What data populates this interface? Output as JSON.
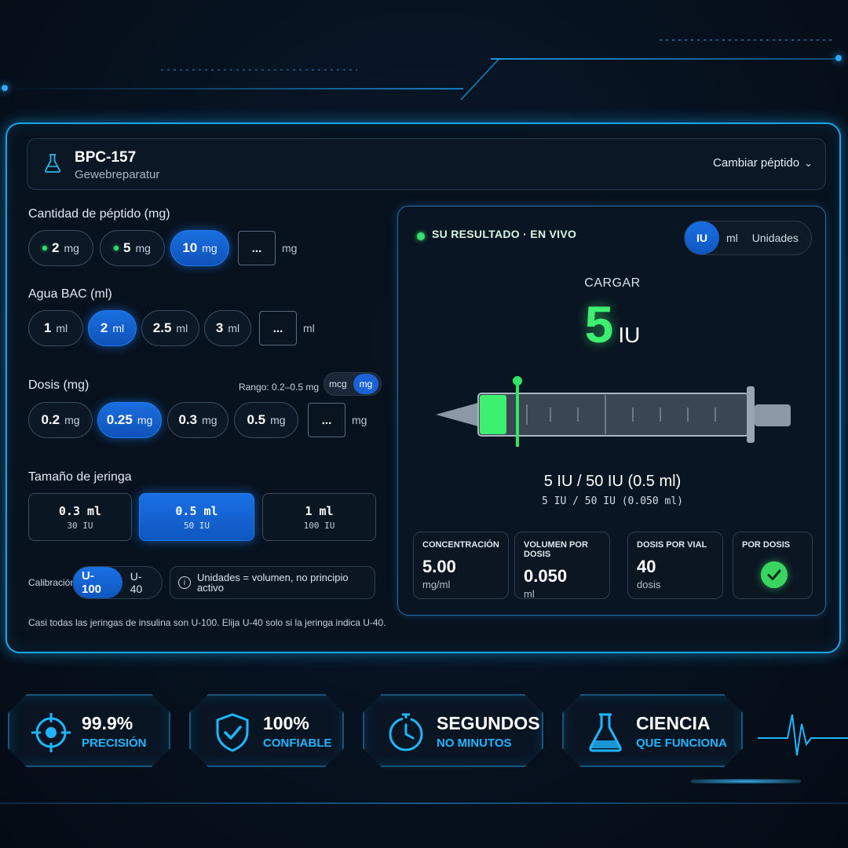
{
  "header": {
    "peptide_name": "BPC-157",
    "peptide_subtitle": "Gewebreparatur",
    "change_label": "Cambiar péptido"
  },
  "peptide_amount": {
    "label": "Cantidad de péptido (mg)",
    "options": [
      {
        "value": "2",
        "unit": "mg",
        "active": false
      },
      {
        "value": "5",
        "unit": "mg",
        "active": false
      },
      {
        "value": "10",
        "unit": "mg",
        "active": true
      }
    ],
    "custom_placeholder": "...",
    "custom_unit": "mg"
  },
  "bac_water": {
    "label": "Agua BAC (ml)",
    "options": [
      {
        "value": "1",
        "unit": "ml",
        "active": false
      },
      {
        "value": "2",
        "unit": "ml",
        "active": true
      },
      {
        "value": "2.5",
        "unit": "ml",
        "active": false
      },
      {
        "value": "3",
        "unit": "ml",
        "active": false
      }
    ],
    "custom_placeholder": "...",
    "custom_unit": "ml"
  },
  "dose": {
    "label": "Dosis (mg)",
    "range_text": "Rango: 0.2–0.5 mg",
    "unit_toggle": [
      "mcg",
      "mg"
    ],
    "unit_active": "mg",
    "options": [
      {
        "value": "0.2",
        "unit": "mg",
        "active": false
      },
      {
        "value": "0.25",
        "unit": "mg",
        "active": true
      },
      {
        "value": "0.3",
        "unit": "mg",
        "active": false
      },
      {
        "value": "0.5",
        "unit": "mg",
        "active": false
      }
    ],
    "custom_placeholder": "...",
    "custom_unit": "mg"
  },
  "syringe_size": {
    "label": "Tamaño de jeringa",
    "options": [
      {
        "ml": "0.3 ml",
        "iu": "30 IU",
        "active": false
      },
      {
        "ml": "0.5 ml",
        "iu": "50 IU",
        "active": true
      },
      {
        "ml": "1 ml",
        "iu": "100 IU",
        "active": false
      }
    ]
  },
  "calibration": {
    "label": "Calibración",
    "options": [
      "U-100",
      "U-40"
    ],
    "active": "U-100",
    "info_text": "Unidades = volumen, no principio activo",
    "note": "Casi todas las jeringas de insulina son U-100. Elija U-40 solo si la jeringa indica U-40."
  },
  "result": {
    "live_label": "SU RESULTADO · EN VIVO",
    "unit_options": [
      "IU",
      "ml",
      "Unidades"
    ],
    "unit_active": "IU",
    "load_label": "CARGAR",
    "load_value": "5",
    "load_unit": "IU",
    "syringe_fill_fraction": 0.1,
    "summary_main": "5 IU / 50 IU (0.5 ml)",
    "summary_sub": "5 IU / 50 IU (0.050 ml)",
    "stats": [
      {
        "title": "CONCENTRACIÓN",
        "value": "5.00",
        "unit": "mg/ml"
      },
      {
        "title": "VOLUMEN POR DOSIS",
        "value": "0.050",
        "unit": "ml"
      },
      {
        "title": "DOSIS POR VIAL",
        "value": "40",
        "unit": "dosis"
      },
      {
        "title": "POR DOSIS",
        "value": "",
        "unit": ""
      }
    ]
  },
  "badges": [
    {
      "title": "99.9%",
      "subtitle": "PRECISIÓN",
      "icon": "crosshair-icon"
    },
    {
      "title": "100%",
      "subtitle": "CONFIABLE",
      "icon": "shield-check-icon"
    },
    {
      "title": "SEGUNDOS",
      "subtitle": "NO MINUTOS",
      "icon": "stopwatch-icon"
    },
    {
      "title": "CIENCIA",
      "subtitle": "QUE FUNCIONA",
      "icon": "flask-icon"
    }
  ],
  "colors": {
    "accent_blue": "#1a70e4",
    "live_green": "#3ef06f",
    "frame_cyan": "#1aa6ee"
  }
}
